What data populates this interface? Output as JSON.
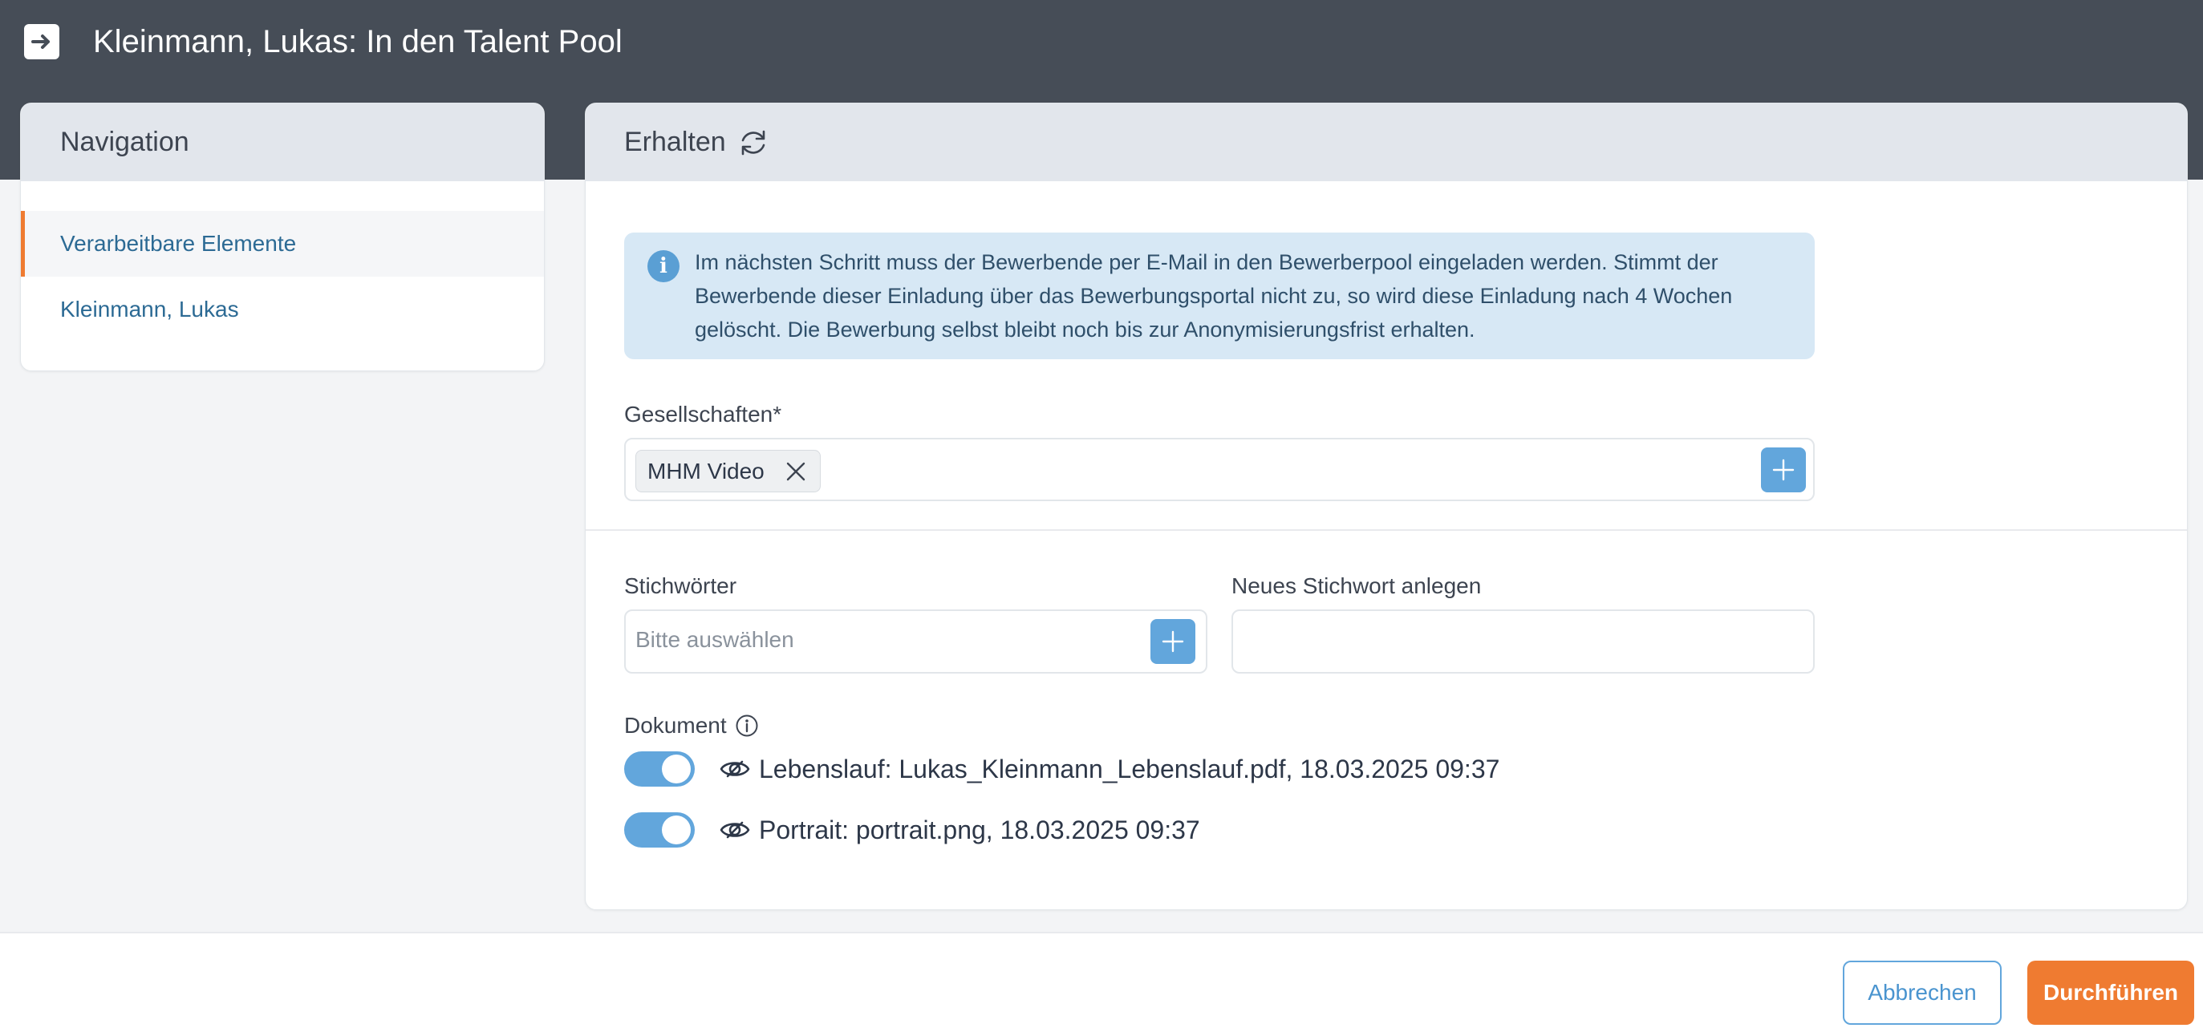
{
  "header": {
    "title": "Kleinmann, Lukas: In den Talent Pool",
    "exit_icon": "arrow-right-icon"
  },
  "navigation": {
    "title": "Navigation",
    "items": [
      {
        "label": "Verarbeitbare Elemente",
        "active": true
      },
      {
        "label": "Kleinmann, Lukas",
        "active": false
      }
    ]
  },
  "main": {
    "title": "Erhalten",
    "title_icon": "reload-icon",
    "info_text": "Im nächsten Schritt muss der Bewerbende per E-Mail in den Bewerberpool eingeladen werden. Stimmt der Bewerbende dieser Einladung über das Bewerbungsportal nicht zu, so wird diese Einladung nach 4 Wochen gelöscht. Die Bewerbung selbst bleibt noch bis zur Anonymisierungsfrist erhalten.",
    "companies": {
      "label": "Gesellschaften*",
      "selected": [
        "MHM Video"
      ]
    },
    "keywords": {
      "label": "Stichwörter",
      "placeholder": "Bitte auswählen"
    },
    "new_keyword": {
      "label": "Neues Stichwort anlegen",
      "value": ""
    },
    "documents": {
      "label": "Dokument",
      "items": [
        {
          "text": "Lebenslauf: Lukas_Kleinmann_Lebenslauf.pdf, 18.03.2025 09:37",
          "enabled": true
        },
        {
          "text": "Portrait: portrait.png, 18.03.2025 09:37",
          "enabled": true
        }
      ]
    }
  },
  "footer": {
    "cancel_label": "Abbrechen",
    "submit_label": "Durchführen"
  },
  "colors": {
    "accent": "#ef7b31",
    "primary": "#62a6dc",
    "header_bg": "#464d57"
  }
}
